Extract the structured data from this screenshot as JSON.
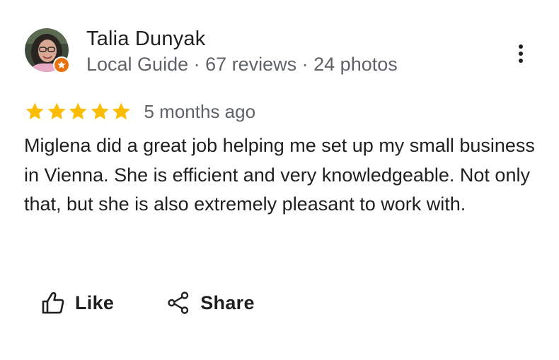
{
  "reviewer": {
    "name": "Talia Dunyak",
    "meta": "Local Guide · 67 reviews · 24 photos",
    "avatar_icon": "profile-photo",
    "badge_icon": "local-guide-star-icon",
    "badge_color": "#e8710a"
  },
  "review": {
    "rating": 5,
    "max_rating": 5,
    "star_color": "#fbbc04",
    "date": "5 months ago",
    "text": "Miglena did a great job helping me set up my small business in Vienna. She is efficient and very knowledgeable. Not only that, but she is also extremely pleasant to work with."
  },
  "actions": {
    "like_label": "Like",
    "like_icon": "thumbs-up-icon",
    "share_label": "Share",
    "share_icon": "share-icon"
  },
  "menu": {
    "more_icon": "more-vert-icon"
  }
}
